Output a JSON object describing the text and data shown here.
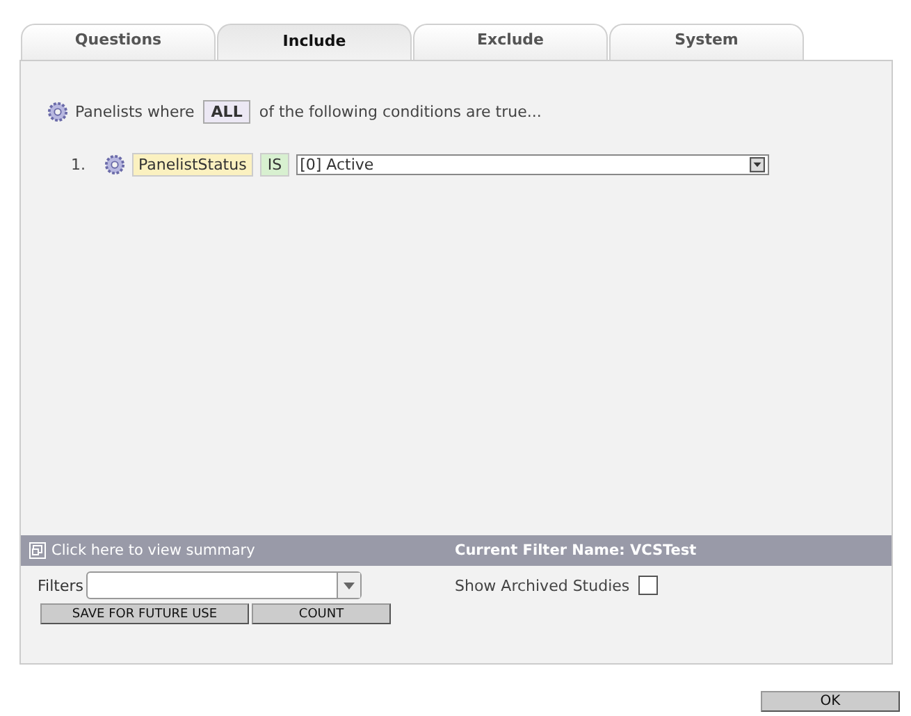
{
  "tabs": [
    {
      "label": "Questions",
      "selected": false
    },
    {
      "label": "Include",
      "selected": true
    },
    {
      "label": "Exclude",
      "selected": false
    },
    {
      "label": "System",
      "selected": false
    }
  ],
  "criteria": {
    "prefix": "Panelists where",
    "match": "ALL",
    "suffix": "of the following conditions are true..."
  },
  "conditions": [
    {
      "number": "1.",
      "field": "PanelistStatus",
      "operator": "IS",
      "value": "[0] Active"
    }
  ],
  "summary_bar": {
    "link": "Click here to view summary",
    "filter_name": "Current Filter Name: VCSTest"
  },
  "filters": {
    "label": "Filters"
  },
  "show_archived": {
    "label": "Show Archived Studies",
    "checked": false
  },
  "buttons": [
    "SAVE FOR FUTURE USE",
    "COUNT"
  ],
  "ok_button": "OK"
}
